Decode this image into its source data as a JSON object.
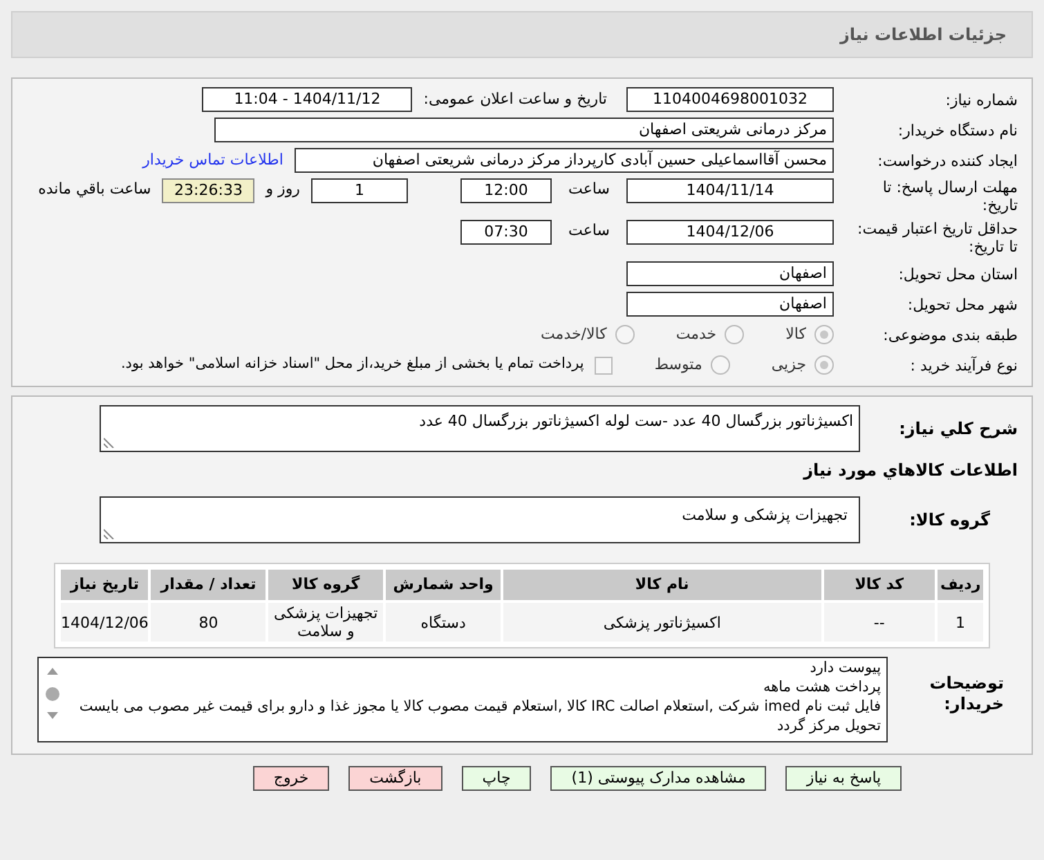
{
  "header": {
    "title": "جزئيات اطلاعات نياز"
  },
  "need_number": {
    "label": "شماره نياز:",
    "value": "1104004698001032"
  },
  "announce": {
    "label": "تاریخ و ساعت اعلان عمومی:",
    "value": "1404/11/12 - 11:04"
  },
  "buyer": {
    "label": "نام دستگاه خريدار:",
    "value": "مرکز درمانی شریعتی اصفهان"
  },
  "requester": {
    "label": "ایجاد کننده درخواست:",
    "value": "محسن آقااسماعیلی حسین آبادی کارپرداز مرکز درمانی شریعتی اصفهان",
    "link": "اطلاعات تماس خریدار"
  },
  "deadline": {
    "label": "مهلت ارسال پاسخ: تا تاریخ:",
    "date": "1404/11/14",
    "time_label": "ساعت",
    "time": "12:00",
    "days": "1",
    "days_label": "روز و",
    "remaining": "23:26:33",
    "remaining_label": "ساعت باقي مانده"
  },
  "validity": {
    "label": "حداقل تاریخ اعتبار قیمت: تا تاریخ:",
    "date": "1404/12/06",
    "time_label": "ساعت",
    "time": "07:30"
  },
  "province": {
    "label": "استان محل تحویل:",
    "value": "اصفهان"
  },
  "city": {
    "label": "شهر محل تحویل:",
    "value": "اصفهان"
  },
  "category": {
    "label": "طبقه بندی موضوعی:",
    "options": [
      {
        "label": "کالا",
        "selected": true
      },
      {
        "label": "خدمت",
        "selected": false
      },
      {
        "label": "کالا/خدمت",
        "selected": false
      }
    ]
  },
  "process": {
    "label": "نوع فرآیند خرید :",
    "options": [
      {
        "label": "جزیی",
        "selected": true
      },
      {
        "label": "متوسط",
        "selected": false
      }
    ],
    "payment": {
      "label": "پرداخت تمام یا بخشی از مبلغ خرید،از محل \"اسناد خزانه اسلامی\" خواهد بود.",
      "checked": false
    }
  },
  "summary": {
    "label": "شرح کلي نياز:",
    "value": "اکسیژناتور بزرگسال 40 عدد -ست لوله اکسیژناتور بزرگسال 40 عدد"
  },
  "goods_title": "اطلاعات کالاهاي مورد نياز",
  "goods_group": {
    "label": "گروه کالا:",
    "value": "تجهیزات پزشکی و سلامت"
  },
  "table": {
    "columns": [
      "ردیف",
      "کد کالا",
      "نام کالا",
      "واحد شمارش",
      "گروه کالا",
      "تعداد / مقدار",
      "تاریخ نیاز"
    ],
    "rows": [
      [
        "1",
        "--",
        "اکسیژناتور پزشکی",
        "دستگاه",
        "تجهیزات پزشکی و سلامت",
        "80",
        "1404/12/06"
      ]
    ]
  },
  "notes": {
    "label": "توضیحات خریدار:",
    "lines": [
      "پیوست دارد",
      "پرداخت هشت ماهه",
      "فایل ثبت نام imed شرکت ,استعلام اصالت IRC کالا ,استعلام قیمت مصوب کالا یا مجوز غذا و دارو برای قیمت غیر مصوب می بایست تحویل مرکز گردد"
    ]
  },
  "buttons": [
    {
      "label": "پاسخ به نیاز",
      "kind": "action"
    },
    {
      "label": "مشاهده مدارک پیوستی (1)",
      "kind": "action"
    },
    {
      "label": "چاپ",
      "kind": "action"
    },
    {
      "label": "بازگشت",
      "kind": "exit"
    },
    {
      "label": "خروج",
      "kind": "exit"
    }
  ]
}
